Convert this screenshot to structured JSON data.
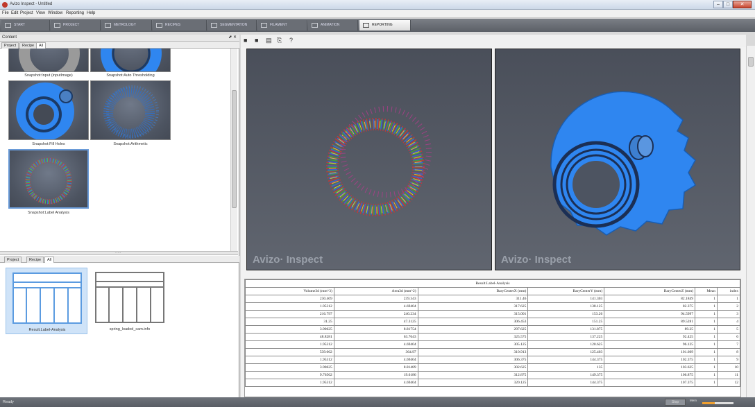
{
  "window": {
    "title": "Avizo Inspect - Untitled",
    "min_label": "–",
    "max_label": "□",
    "close_label": "✕"
  },
  "menu": [
    "File",
    "Edit",
    "Project",
    "View",
    "Window",
    "Reporting",
    "Help"
  ],
  "tabs": [
    {
      "label": "START",
      "active": false
    },
    {
      "label": "PROJECT",
      "active": false
    },
    {
      "label": "METROLOGY",
      "active": false
    },
    {
      "label": "RECIPES",
      "active": false
    },
    {
      "label": "SEGMENTATION",
      "active": false
    },
    {
      "label": "FILAMENT",
      "active": false
    },
    {
      "label": "ANIMATION",
      "active": false
    },
    {
      "label": "REPORTING",
      "active": true
    }
  ],
  "content_panel": {
    "title": "Content",
    "buttons": "⬈ ✕",
    "subtabs": [
      "Project",
      "Recipe",
      "All"
    ],
    "snapshots": [
      {
        "label": "Snapshot:Input (inputImage)"
      },
      {
        "label": "Snapshot:Auto Thresholding"
      },
      {
        "label": "Snapshot:Fill Holes"
      },
      {
        "label": "Snapshot:Arithmetic"
      },
      {
        "label": "Snapshot:Label Analysis"
      }
    ],
    "splitter_grip": "....."
  },
  "objects_panel": {
    "subtabs": [
      "Project",
      "Recipe",
      "All"
    ],
    "items": [
      {
        "label": "Result.Label-Analysis",
        "selected": true
      },
      {
        "label": "spring_loaded_cam.info",
        "selected": false
      }
    ]
  },
  "report_toolbar": {
    "icons": [
      "folder-open-icon",
      "save-icon",
      "trash-icon",
      "export-icon",
      "help-icon"
    ],
    "glyphs": [
      "■",
      "■",
      "▤",
      "⎘",
      "?"
    ]
  },
  "viewers": [
    {
      "brand": "Avizo· Inspect"
    },
    {
      "brand": "Avizo· Inspect"
    }
  ],
  "result_table": {
    "caption": "Result.Label-Analysis",
    "columns": [
      "Volume3d (mm^3)",
      "Area3d (mm^2)",
      "BaryCenterX (mm)",
      "BaryCenterY (mm)",
      "BaryCenterZ (mm)",
      "Mean",
      "index"
    ],
    "rows": [
      [
        "230.469",
        "239.343",
        "311.46",
        "141.303",
        "82.1849",
        "1",
        "1"
      ],
      [
        "1.95312",
        "4.69404",
        "317.625",
        "138.125",
        "82.375",
        "1",
        "2"
      ],
      [
        "216.797",
        "240.234",
        "315.001",
        "153.26",
        "94.5997",
        "1",
        "3"
      ],
      [
        "31.25",
        "47.3125",
        "306.453",
        "151.25",
        "89.5281",
        "1",
        "4"
      ],
      [
        "3.90625",
        "8.81754",
        "297.625",
        "131.875",
        "89.25",
        "1",
        "5"
      ],
      [
        "48.8281",
        "63.7643",
        "325.575",
        "137.225",
        "92.425",
        "1",
        "6"
      ],
      [
        "1.95312",
        "4.69404",
        "305.125",
        "120.625",
        "96.125",
        "1",
        "7"
      ],
      [
        "539.062",
        "364.97",
        "310.913",
        "125.403",
        "101.609",
        "1",
        "8"
      ],
      [
        "1.95312",
        "4.69404",
        "306.375",
        "144.375",
        "102.375",
        "1",
        "9"
      ],
      [
        "3.90625",
        "8.81489",
        "302.625",
        "135",
        "103.625",
        "1",
        "10"
      ],
      [
        "9.76562",
        "19.6186",
        "312.875",
        "149.375",
        "106.875",
        "1",
        "11"
      ],
      [
        "1.95312",
        "4.69404",
        "320.125",
        "144.375",
        "107.375",
        "1",
        "12"
      ]
    ]
  },
  "status": {
    "text": "Ready",
    "stop_label": "Stop",
    "mem_label": "Mem"
  }
}
